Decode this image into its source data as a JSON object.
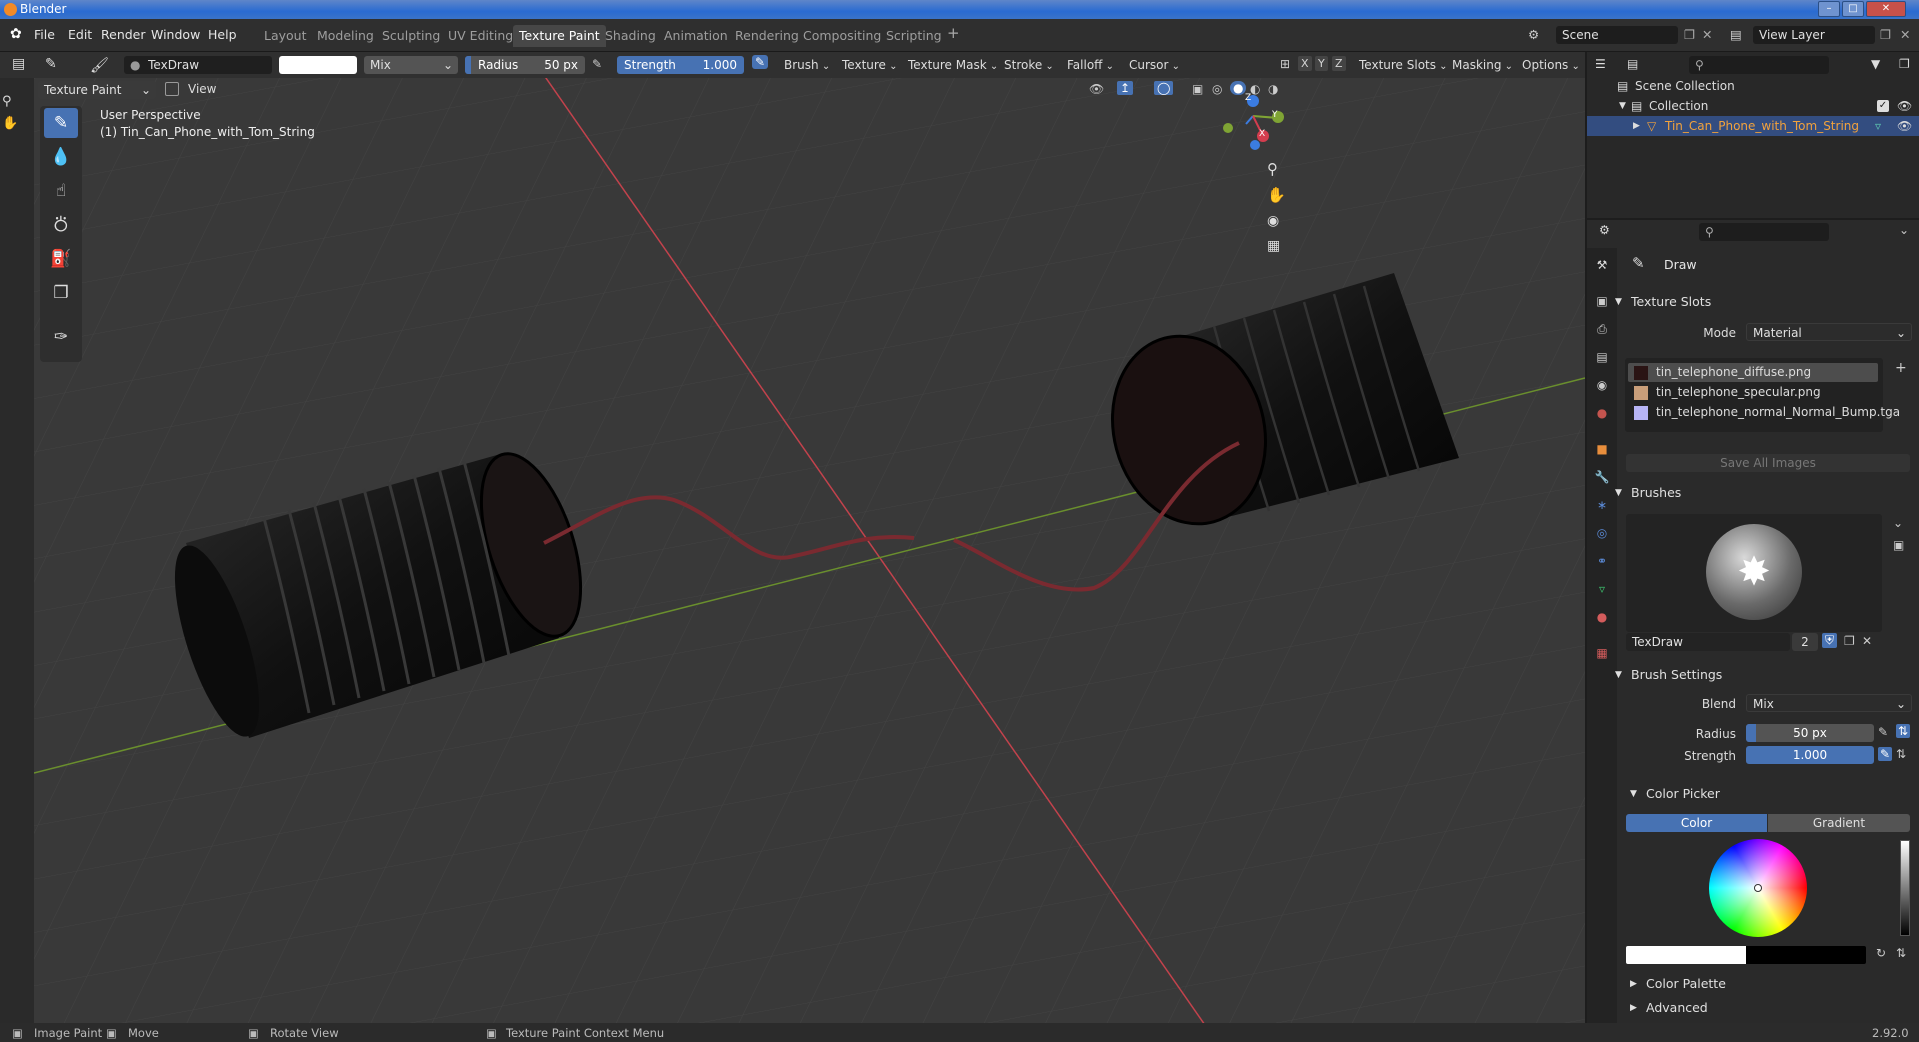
{
  "app": {
    "title": "Blender",
    "version": "2.92.0"
  },
  "menu": [
    "File",
    "Edit",
    "Render",
    "Window",
    "Help"
  ],
  "workspaces": [
    "Layout",
    "Modeling",
    "Sculpting",
    "UV Editing",
    "Texture Paint",
    "Shading",
    "Animation",
    "Rendering",
    "Compositing",
    "Scripting"
  ],
  "active_workspace": "Texture Paint",
  "scene": {
    "name": "Scene",
    "view_layer": "View Layer"
  },
  "toolheader": {
    "brush_name": "TexDraw",
    "blend": "Mix",
    "radius_label": "Radius",
    "radius_value": "50 px",
    "strength_label": "Strength",
    "strength_value": "1.000",
    "menus": [
      "Brush",
      "Texture",
      "Texture Mask",
      "Stroke",
      "Falloff",
      "Cursor"
    ],
    "axes": [
      "X",
      "Y",
      "Z"
    ],
    "right_menus": [
      "Texture Slots",
      "Masking",
      "Options"
    ]
  },
  "vpheader": {
    "mode": "Texture Paint",
    "view": "View"
  },
  "viewport": {
    "perspective": "User Perspective",
    "object_line": "(1) Tin_Can_Phone_with_Tom_String",
    "gizmo": {
      "x": "X",
      "y": "Y",
      "z": "Z"
    }
  },
  "outliner": {
    "rows": [
      "Scene Collection",
      "Collection",
      "Tin_Can_Phone_with_Tom_String"
    ]
  },
  "properties": {
    "tool_name": "Draw",
    "texture_slots": {
      "header": "Texture Slots",
      "mode_label": "Mode",
      "mode_value": "Material",
      "slots": [
        {
          "name": "tin_telephone_diffuse.png",
          "color": "#2a1414"
        },
        {
          "name": "tin_telephone_specular.png",
          "color": "#c89e7a"
        },
        {
          "name": "tin_telephone_normal_Normal_Bump.tga",
          "color": "#b7b4f5"
        }
      ],
      "save_all": "Save All Images"
    },
    "brushes": {
      "header": "Brushes",
      "brush_name": "TexDraw",
      "users": "2"
    },
    "brush_settings": {
      "header": "Brush Settings",
      "blend_label": "Blend",
      "blend_value": "Mix",
      "radius_label": "Radius",
      "radius_value": "50 px",
      "strength_label": "Strength",
      "strength_value": "1.000"
    },
    "color_picker": {
      "header": "Color Picker",
      "tab_color": "Color",
      "tab_gradient": "Gradient"
    },
    "color_palette": "Color Palette",
    "advanced": "Advanced"
  },
  "statusbar": {
    "items": [
      "Image Paint",
      "Move",
      "Rotate View",
      "Texture Paint Context Menu"
    ]
  },
  "colors": {
    "accent": "#4772b3",
    "x_axis": "#d43d4e",
    "y_axis": "#7fa434",
    "z_axis": "#3b7ce1"
  }
}
